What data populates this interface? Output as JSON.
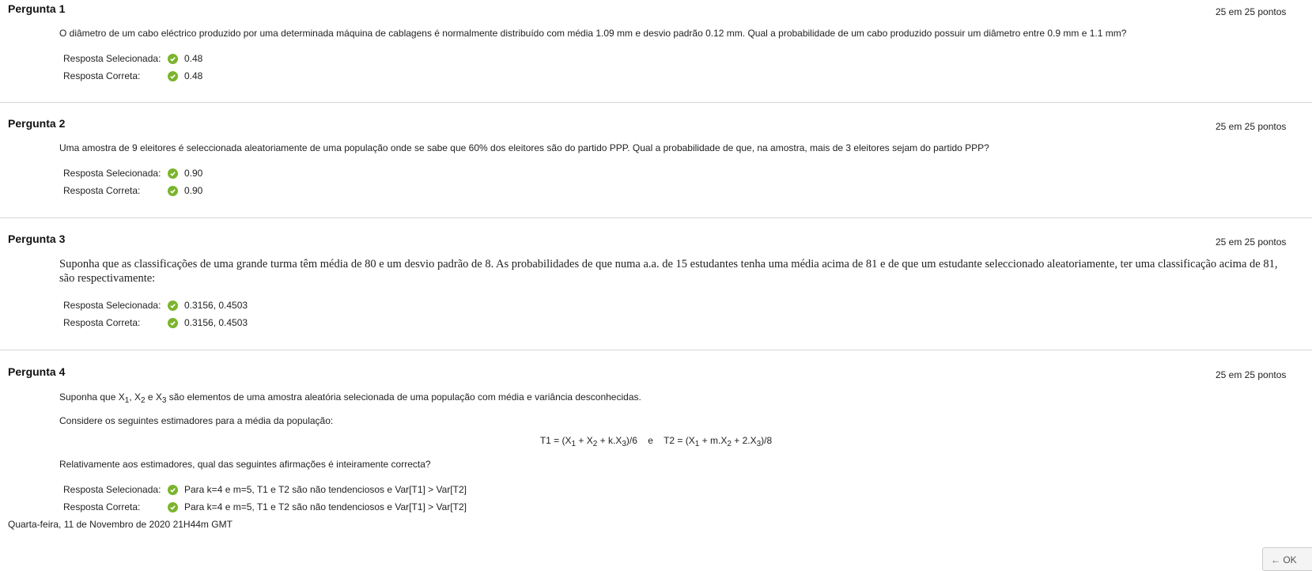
{
  "questions": [
    {
      "title": "Pergunta 1",
      "points": "25 em 25 pontos",
      "text": "O diâmetro de um cabo eléctrico produzido por uma determinada máquina de cablagens é normalmente distribuído com média 1.09 mm e desvio padrão 0.12 mm. Qual a probabilidade de um cabo produzido possuir um diâmetro entre 0.9 mm e 1.1 mm?",
      "selected_label": "Resposta Selecionada:",
      "selected_value": "0.48",
      "correct_label": "Resposta Correta:",
      "correct_value": "0.48"
    },
    {
      "title": "Pergunta 2",
      "points": "25 em 25 pontos",
      "text": "Uma amostra de 9 eleitores é seleccionada aleatoriamente de uma população onde se sabe que 60% dos eleitores são do partido PPP. Qual a probabilidade de que, na amostra, mais de 3 eleitores sejam do partido PPP?",
      "selected_label": "Resposta Selecionada:",
      "selected_value": "0.90",
      "correct_label": "Resposta Correta:",
      "correct_value": "0.90"
    },
    {
      "title": "Pergunta 3",
      "points": "25 em 25 pontos",
      "text": "Suponha que as classificações de uma grande turma têm média de 80 e um desvio padrão de 8. As probabilidades de que numa a.a. de 15 estudantes tenha uma média acima de 81 e de que um estudante seleccionado aleatoriamente, ter uma classificação acima de 81, são respectivamente:",
      "selected_label": "Resposta Selecionada:",
      "selected_value": "0.3156, 0.4503",
      "correct_label": "Resposta Correta:",
      "correct_value": "0.3156, 0.4503"
    },
    {
      "title": "Pergunta 4",
      "points": "25 em 25 pontos",
      "text_line1_prefix": "Suponha que X",
      "text_line1_sub1": "1",
      "text_line1_sep1": ", X",
      "text_line1_sub2": "2",
      "text_line1_sep2": " e X",
      "text_line1_sub3": "3",
      "text_line1_suffix": " são elementos de uma amostra aleatória selecionada de uma população com média e variância desconhecidas.",
      "text_line2": "Considere os seguintes estimadores para a média da população:",
      "formula_t1_a": "T1 = (X",
      "formula_t1_b": " + X",
      "formula_t1_c": " + k.X",
      "formula_t1_d": ")/6",
      "formula_and": "e",
      "formula_t2_a": "T2 = (X",
      "formula_t2_b": " + m.X",
      "formula_t2_c": " + 2.X",
      "formula_t2_d": ")/8",
      "sub_1": "1",
      "sub_2": "2",
      "sub_3": "3",
      "text_line3": "Relativamente aos estimadores, qual das seguintes afirmações é inteiramente correcta?",
      "selected_label": "Resposta Selecionada:",
      "selected_value": "Para k=4 e m=5, T1 e T2 são não tendenciosos e Var[T1] > Var[T2]",
      "correct_label": "Resposta Correta:",
      "correct_value": "Para k=4 e m=5, T1 e T2 são não tendenciosos e Var[T1] > Var[T2]"
    }
  ],
  "footer": {
    "date": "Quarta-feira, 11 de Novembro de 2020 21H44m GMT",
    "ok_label": "← OK"
  },
  "colors": {
    "check": "#7bb42d",
    "separator": "#d6d6d6"
  },
  "icons": {
    "answer_status": "check-circle-icon"
  }
}
